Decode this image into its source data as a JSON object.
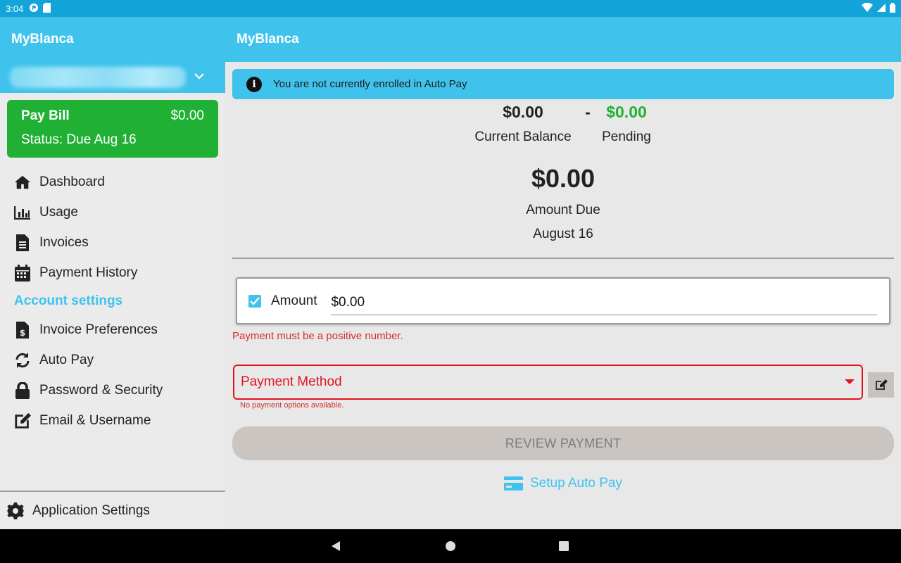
{
  "status_bar": {
    "time": "3:04"
  },
  "sidebar": {
    "app_title": "MyBlanca",
    "pay_bill": {
      "title": "Pay Bill",
      "amount": "$0.00",
      "status": "Status: Due Aug 16"
    },
    "items": [
      {
        "label": "Dashboard",
        "icon": "home-icon"
      },
      {
        "label": "Usage",
        "icon": "bar-chart-icon"
      },
      {
        "label": "Invoices",
        "icon": "document-icon"
      },
      {
        "label": "Payment History",
        "icon": "calendar-icon"
      }
    ],
    "section_label": "Account settings",
    "settings_items": [
      {
        "label": "Invoice Preferences",
        "icon": "invoice-dollar-icon"
      },
      {
        "label": "Auto Pay",
        "icon": "sync-icon"
      },
      {
        "label": "Password & Security",
        "icon": "lock-icon"
      },
      {
        "label": "Email & Username",
        "icon": "edit-icon"
      }
    ],
    "footer_label": "Application Settings"
  },
  "main": {
    "header_title": "MyBlanca",
    "banner_text": "You are not currently enrolled in Auto Pay",
    "current_balance": {
      "value": "$0.00",
      "label": "Current Balance"
    },
    "separator": "-",
    "pending": {
      "value": "$0.00",
      "label": "Pending"
    },
    "amount_due": {
      "value": "$0.00",
      "label": "Amount Due",
      "date": "August 16"
    },
    "amount_field": {
      "label": "Amount",
      "value": "$0.00"
    },
    "amount_error": "Payment must be a positive number.",
    "payment_method": {
      "label": "Payment Method",
      "error": "No payment options available."
    },
    "review_button": "REVIEW PAYMENT",
    "setup_autopay": "Setup Auto Pay"
  },
  "colors": {
    "primary": "#3fc3ec",
    "status_bar": "#13a5d9",
    "pay_bill_green": "#20b134",
    "pending_green": "#20b134",
    "error_red": "#e0141e"
  }
}
